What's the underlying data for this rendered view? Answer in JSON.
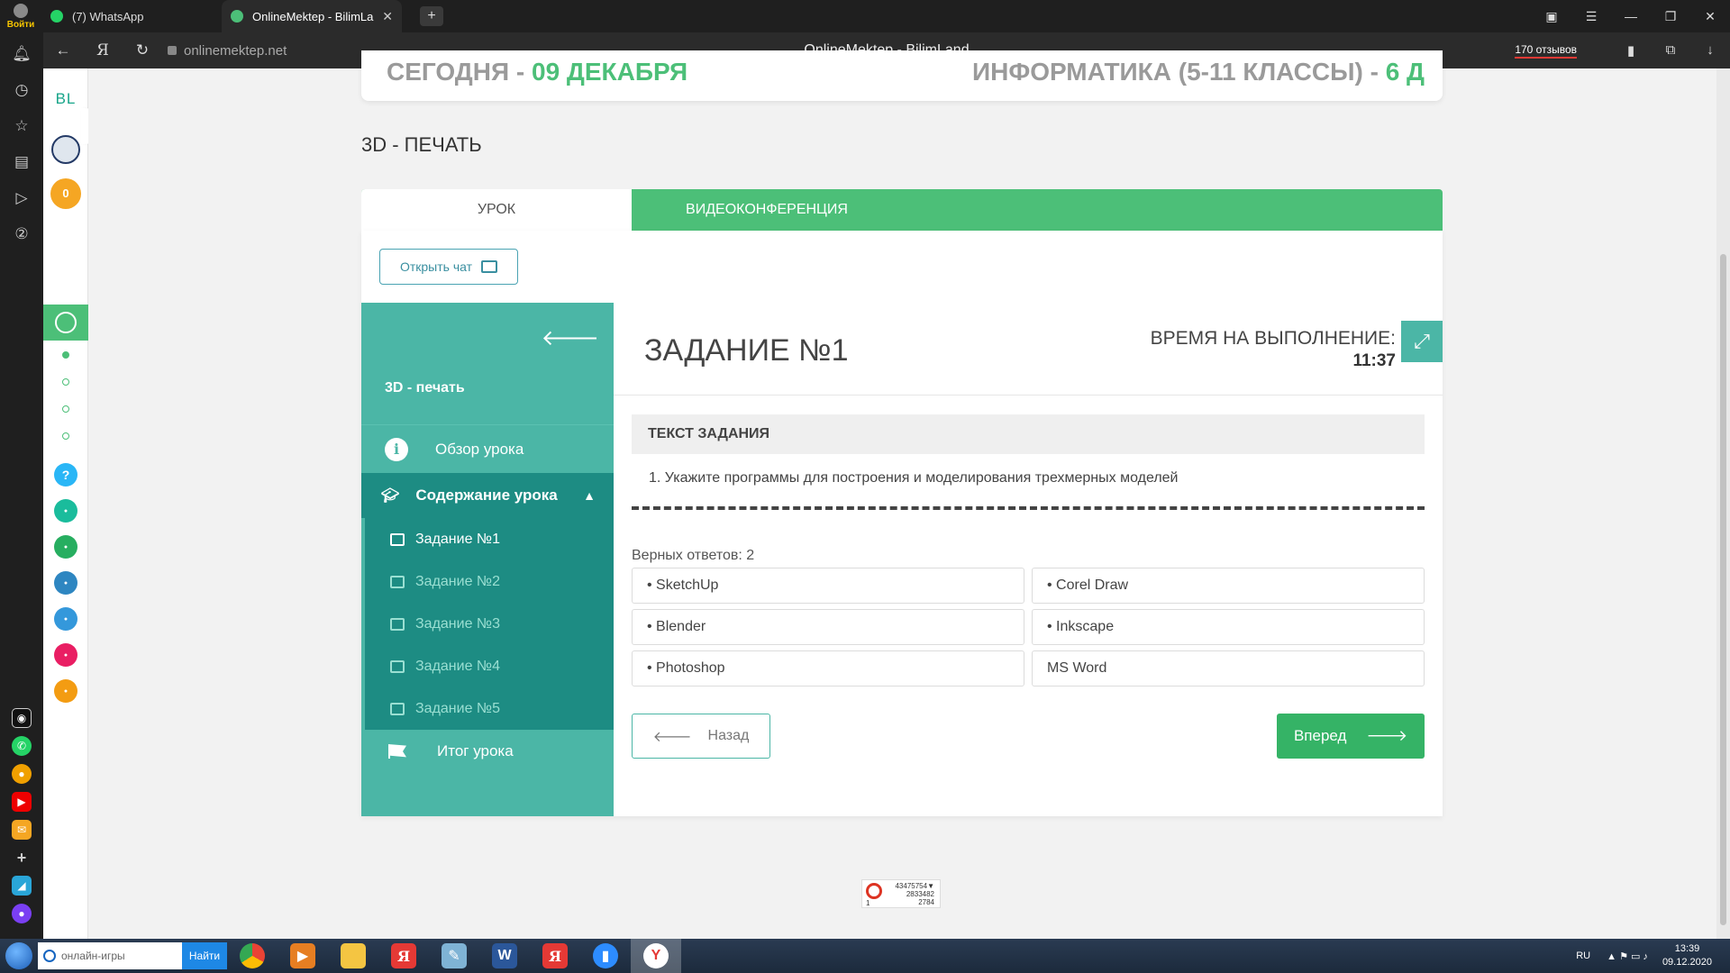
{
  "browser": {
    "login_label": "Войти",
    "tabs": [
      {
        "label": "(7) WhatsApp"
      },
      {
        "label": "OnlineMektep - BilimLa"
      }
    ],
    "url": "onlinemektep.net",
    "page_title": "OnlineMektep - BilimLand",
    "reviews": "170 отзывов"
  },
  "rail": {
    "logo": "BL",
    "coins": "0"
  },
  "header": {
    "left_prefix": "СЕГОДНЯ - ",
    "left_date": "09 ДЕКАБРЯ",
    "right_prefix": "ИНФОРМАТИКА (5-11 КЛАССЫ) - ",
    "right_suffix": "6 Д"
  },
  "lesson": {
    "title": "3D - ПЕЧАТЬ",
    "tabs": [
      {
        "label": "УРОК"
      },
      {
        "label": "ВИДЕОКОНФЕРЕНЦИЯ"
      }
    ],
    "open_chat": "Открыть чат"
  },
  "nav": {
    "course": "3D - печать",
    "overview": "Обзор урока",
    "content": "Содержание урока",
    "tasks": [
      {
        "label": "Задание №1"
      },
      {
        "label": "Задание №2"
      },
      {
        "label": "Задание №3"
      },
      {
        "label": "Задание №4"
      },
      {
        "label": "Задание №5"
      }
    ],
    "summary": "Итог урока"
  },
  "task": {
    "title": "ЗАДАНИЕ №1",
    "time_label": "ВРЕМЯ НА ВЫПОЛНЕНИЕ:",
    "time_value": "11:37",
    "text_header": "ТЕКСТ ЗАДАНИЯ",
    "question": "1. Укажите программы для построения и моделирования трехмерных моделей",
    "correct_count": "Верных ответов: 2",
    "answers": [
      {
        "label": "• SketchUp"
      },
      {
        "label": "• Corel Draw"
      },
      {
        "label": "• Blender"
      },
      {
        "label": "• Inkscape"
      },
      {
        "label": "• Photoshop"
      },
      {
        "label": "MS Word"
      }
    ],
    "back": "Назад",
    "next": "Вперед"
  },
  "counter": {
    "line1": "43475754▼",
    "line2": "2833482",
    "line3": "2784",
    "left": "1"
  },
  "taskbar": {
    "search_placeholder": "онлайн-игры",
    "search_button": "Найти",
    "lang": "RU",
    "time": "13:39",
    "date": "09.12.2020"
  }
}
